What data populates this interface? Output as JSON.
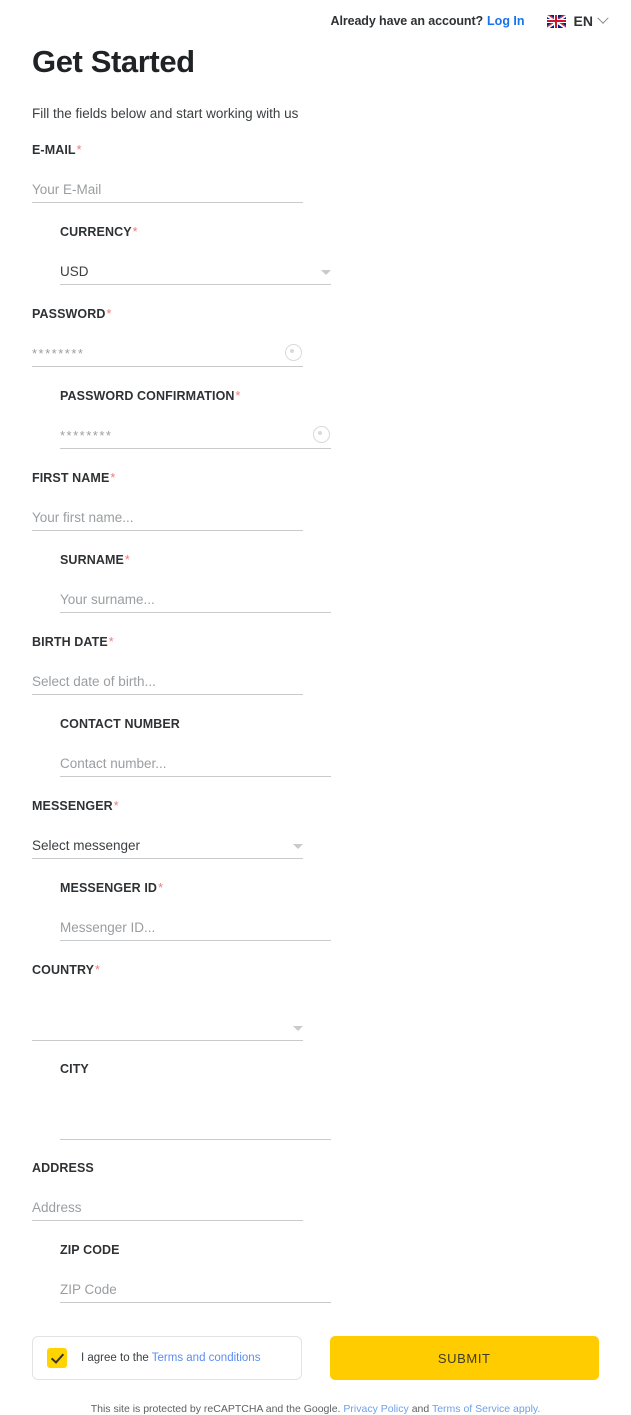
{
  "topbar": {
    "account_prompt": "Already have an account?",
    "login_label": "Log In",
    "language": "EN",
    "flag_icon": "uk-flag-icon",
    "chevron_icon": "chevron-down-icon"
  },
  "header": {
    "title": "Get Started",
    "subtitle": "Fill the fields below and start working with us"
  },
  "fields": {
    "email": {
      "label": "E-MAIL",
      "required": "*",
      "value": "Your E-Mail"
    },
    "currency": {
      "label": "CURRENCY",
      "required": "*",
      "value": "USD"
    },
    "password": {
      "label": "PASSWORD",
      "required": "*",
      "value": "********"
    },
    "password_confirmation": {
      "label": "PASSWORD CONFIRMATION",
      "required": "*",
      "value": "********"
    },
    "first_name": {
      "label": "FIRST NAME",
      "required": "*",
      "value": "Your first name..."
    },
    "surname": {
      "label": "SURNAME",
      "required": "*",
      "value": "Your surname..."
    },
    "birth_date": {
      "label": "BIRTH DATE",
      "required": "*",
      "value": "Select date of birth..."
    },
    "contact_number": {
      "label": "CONTACT NUMBER",
      "required": "",
      "value": "Contact number..."
    },
    "messenger": {
      "label": "MESSENGER",
      "required": "*",
      "value": "Select messenger"
    },
    "messenger_id": {
      "label": "MESSENGER ID",
      "required": "*",
      "value": "Messenger ID..."
    },
    "country": {
      "label": "COUNTRY",
      "required": "*",
      "value": ""
    },
    "city": {
      "label": "CITY",
      "required": "",
      "value": ""
    },
    "address": {
      "label": "ADDRESS",
      "required": "",
      "value": "Address"
    },
    "zip_code": {
      "label": "ZIP CODE",
      "required": "",
      "value": "ZIP Code"
    }
  },
  "agreement": {
    "prefix": "I agree to the",
    "link": "Terms and conditions",
    "checked": "true"
  },
  "submit": {
    "label": "SUBMIT"
  },
  "footer": {
    "text_before": "This site is protected by reCAPTCHA and the Google.",
    "privacy_link": "Privacy Policy",
    "between": "and",
    "terms_link": "Terms of Service apply."
  },
  "colors": {
    "accent_yellow": "#ffcc00",
    "link_blue": "#1a73e8",
    "required_red": "#ef7b7b",
    "underline_gray": "#c9cacb"
  }
}
